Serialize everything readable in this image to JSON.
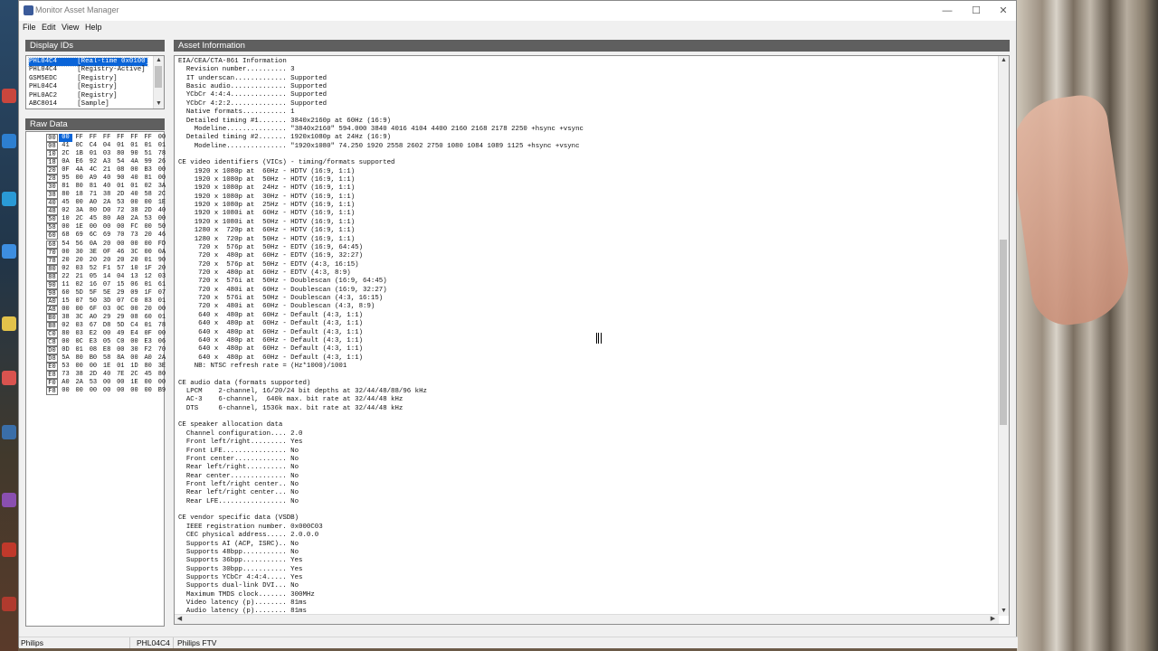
{
  "window": {
    "title": "Monitor Asset Manager"
  },
  "menu": [
    "File",
    "Edit",
    "View",
    "Help"
  ],
  "display_ids": {
    "header": "Display IDs",
    "items": [
      "PHL04C4     [Real-time 0x0100]",
      "PHL04C4     [Registry-Active]",
      "GSM5EDC     [Registry]",
      "PHL04C4     [Registry]",
      "PHL0AC2     [Registry]",
      "ABC8014     [Sample]"
    ],
    "selected_index": 0
  },
  "raw_data": {
    "header": "Raw Data",
    "rows": [
      {
        "addr": "00",
        "bytes": [
          "00",
          "FF",
          "FF",
          "FF",
          "FF",
          "FF",
          "FF",
          "00"
        ]
      },
      {
        "addr": "08",
        "bytes": [
          "41",
          "0C",
          "C4",
          "04",
          "01",
          "01",
          "01",
          "01"
        ]
      },
      {
        "addr": "10",
        "bytes": [
          "2C",
          "1B",
          "01",
          "03",
          "80",
          "90",
          "51",
          "78"
        ]
      },
      {
        "addr": "18",
        "bytes": [
          "0A",
          "E6",
          "92",
          "A3",
          "54",
          "4A",
          "99",
          "26"
        ]
      },
      {
        "addr": "20",
        "bytes": [
          "0F",
          "4A",
          "4C",
          "21",
          "08",
          "00",
          "B3",
          "00"
        ]
      },
      {
        "addr": "28",
        "bytes": [
          "95",
          "00",
          "A9",
          "40",
          "90",
          "40",
          "81",
          "00"
        ]
      },
      {
        "addr": "30",
        "bytes": [
          "81",
          "80",
          "81",
          "40",
          "01",
          "01",
          "02",
          "3A"
        ]
      },
      {
        "addr": "38",
        "bytes": [
          "80",
          "18",
          "71",
          "38",
          "2D",
          "40",
          "58",
          "2C"
        ]
      },
      {
        "addr": "40",
        "bytes": [
          "45",
          "00",
          "A0",
          "2A",
          "53",
          "00",
          "00",
          "1E"
        ]
      },
      {
        "addr": "48",
        "bytes": [
          "02",
          "3A",
          "80",
          "D0",
          "72",
          "38",
          "2D",
          "40"
        ]
      },
      {
        "addr": "50",
        "bytes": [
          "10",
          "2C",
          "45",
          "80",
          "A0",
          "2A",
          "53",
          "00"
        ]
      },
      {
        "addr": "58",
        "bytes": [
          "00",
          "1E",
          "00",
          "00",
          "00",
          "FC",
          "00",
          "50"
        ]
      },
      {
        "addr": "60",
        "bytes": [
          "68",
          "69",
          "6C",
          "69",
          "70",
          "73",
          "20",
          "46"
        ]
      },
      {
        "addr": "68",
        "bytes": [
          "54",
          "56",
          "0A",
          "20",
          "00",
          "00",
          "00",
          "FD"
        ]
      },
      {
        "addr": "70",
        "bytes": [
          "00",
          "30",
          "3E",
          "0F",
          "46",
          "3C",
          "00",
          "0A"
        ]
      },
      {
        "addr": "78",
        "bytes": [
          "20",
          "20",
          "20",
          "20",
          "20",
          "20",
          "01",
          "90"
        ]
      },
      {
        "addr": "80",
        "bytes": [
          "02",
          "03",
          "52",
          "F1",
          "57",
          "10",
          "1F",
          "20"
        ]
      },
      {
        "addr": "88",
        "bytes": [
          "22",
          "21",
          "05",
          "14",
          "04",
          "13",
          "12",
          "03"
        ]
      },
      {
        "addr": "90",
        "bytes": [
          "11",
          "02",
          "16",
          "07",
          "15",
          "06",
          "01",
          "61"
        ]
      },
      {
        "addr": "98",
        "bytes": [
          "60",
          "5D",
          "5F",
          "5E",
          "29",
          "09",
          "1F",
          "07"
        ]
      },
      {
        "addr": "A0",
        "bytes": [
          "15",
          "07",
          "50",
          "3D",
          "07",
          "C0",
          "83",
          "01"
        ]
      },
      {
        "addr": "A8",
        "bytes": [
          "00",
          "00",
          "6F",
          "03",
          "0C",
          "00",
          "20",
          "00"
        ]
      },
      {
        "addr": "B0",
        "bytes": [
          "38",
          "3C",
          "A0",
          "29",
          "29",
          "08",
          "60",
          "01"
        ]
      },
      {
        "addr": "B8",
        "bytes": [
          "02",
          "03",
          "67",
          "D8",
          "5D",
          "C4",
          "01",
          "78"
        ]
      },
      {
        "addr": "C0",
        "bytes": [
          "80",
          "03",
          "E2",
          "00",
          "49",
          "E4",
          "0F",
          "00"
        ]
      },
      {
        "addr": "C8",
        "bytes": [
          "00",
          "0C",
          "E3",
          "05",
          "C0",
          "00",
          "E3",
          "06"
        ]
      },
      {
        "addr": "D0",
        "bytes": [
          "0D",
          "01",
          "08",
          "E8",
          "00",
          "30",
          "F2",
          "70"
        ]
      },
      {
        "addr": "D8",
        "bytes": [
          "5A",
          "80",
          "B0",
          "58",
          "8A",
          "00",
          "A0",
          "2A"
        ]
      },
      {
        "addr": "E0",
        "bytes": [
          "53",
          "00",
          "00",
          "1E",
          "01",
          "1D",
          "80",
          "3E"
        ]
      },
      {
        "addr": "E8",
        "bytes": [
          "73",
          "38",
          "2D",
          "40",
          "7E",
          "2C",
          "45",
          "80"
        ]
      },
      {
        "addr": "F0",
        "bytes": [
          "A0",
          "2A",
          "53",
          "00",
          "00",
          "1E",
          "00",
          "00"
        ]
      },
      {
        "addr": "F8",
        "bytes": [
          "00",
          "00",
          "00",
          "00",
          "00",
          "00",
          "00",
          "B9"
        ]
      }
    ]
  },
  "asset": {
    "header": "Asset Information",
    "lines": [
      "EIA/CEA/CTA-861 Information",
      "  Revision number.......... 3",
      "  IT underscan............. Supported",
      "  Basic audio.............. Supported",
      "  YCbCr 4:4:4.............. Supported",
      "  YCbCr 4:2:2.............. Supported",
      "  Native formats........... 1",
      "  Detailed timing #1....... 3840x2160p at 60Hz (16:9)",
      "    Modeline............... \"3840x2160\" 594.000 3840 4016 4104 4400 2160 2168 2178 2250 +hsync +vsync",
      "  Detailed timing #2....... 1920x1080p at 24Hz (16:9)",
      "    Modeline............... \"1920x1080\" 74.250 1920 2558 2602 2750 1080 1084 1089 1125 +hsync +vsync",
      "",
      "CE video identifiers (VICs) - timing/formats supported",
      "    1920 x 1080p at  60Hz - HDTV (16:9, 1:1)",
      "    1920 x 1080p at  50Hz - HDTV (16:9, 1:1)",
      "    1920 x 1080p at  24Hz - HDTV (16:9, 1:1)",
      "    1920 x 1080p at  30Hz - HDTV (16:9, 1:1)",
      "    1920 x 1080p at  25Hz - HDTV (16:9, 1:1)",
      "    1920 x 1080i at  60Hz - HDTV (16:9, 1:1)",
      "    1920 x 1080i at  50Hz - HDTV (16:9, 1:1)",
      "    1280 x  720p at  60Hz - HDTV (16:9, 1:1)",
      "    1280 x  720p at  50Hz - HDTV (16:9, 1:1)",
      "     720 x  576p at  50Hz - EDTV (16:9, 64:45)",
      "     720 x  480p at  60Hz - EDTV (16:9, 32:27)",
      "     720 x  576p at  50Hz - EDTV (4:3, 16:15)",
      "     720 x  480p at  60Hz - EDTV (4:3, 8:9)",
      "     720 x  576i at  50Hz - Doublescan (16:9, 64:45)",
      "     720 x  480i at  60Hz - Doublescan (16:9, 32:27)",
      "     720 x  576i at  50Hz - Doublescan (4:3, 16:15)",
      "     720 x  480i at  60Hz - Doublescan (4:3, 8:9)",
      "     640 x  480p at  60Hz - Default (4:3, 1:1)",
      "     640 x  480p at  60Hz - Default (4:3, 1:1)",
      "     640 x  480p at  60Hz - Default (4:3, 1:1)",
      "     640 x  480p at  60Hz - Default (4:3, 1:1)",
      "     640 x  480p at  60Hz - Default (4:3, 1:1)",
      "     640 x  480p at  60Hz - Default (4:3, 1:1)",
      "    NB: NTSC refresh rate = (Hz*1000)/1001",
      "",
      "CE audio data (formats supported)",
      "  LPCM    2-channel, 16/20/24 bit depths at 32/44/48/88/96 kHz",
      "  AC-3    6-channel,  640k max. bit rate at 32/44/48 kHz",
      "  DTS     6-channel, 1536k max. bit rate at 32/44/48 kHz",
      "",
      "CE speaker allocation data",
      "  Channel configuration.... 2.0",
      "  Front left/right......... Yes",
      "  Front LFE................ No",
      "  Front center............. No",
      "  Rear left/right.......... No",
      "  Rear center.............. No",
      "  Front left/right center.. No",
      "  Rear left/right center... No",
      "  Rear LFE................. No",
      "",
      "CE vendor specific data (VSDB)",
      "  IEEE registration number. 0x000C03",
      "  CEC physical address..... 2.0.0.0",
      "  Supports AI (ACP, ISRC).. No",
      "  Supports 48bpp........... No",
      "  Supports 36bpp........... Yes",
      "  Supports 30bpp........... Yes",
      "  Supports YCbCr 4:4:4..... Yes",
      "  Supports dual-link DVI... No",
      "  Maximum TMDS clock....... 300MHz",
      "  Video latency (p)........ 81ms",
      "  Audio latency (p)........ 81ms"
    ]
  },
  "status": {
    "manufacturer": "Philips",
    "model_id": "PHL04C4",
    "name": "Philips FTV"
  },
  "colors": {
    "panel_header": "#5f5f5f",
    "selection": "#0a64d8"
  }
}
